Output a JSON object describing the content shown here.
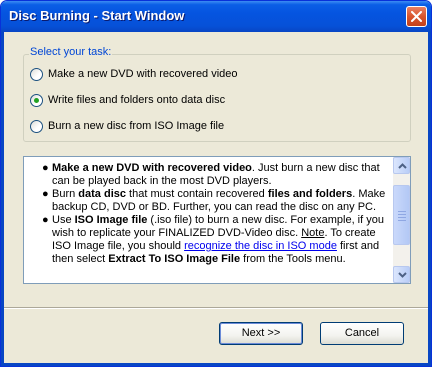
{
  "window": {
    "title": "Disc Burning - Start Window"
  },
  "task_group": {
    "label": "Select your task:",
    "options": [
      {
        "label": "Make a new DVD with recovered video",
        "selected": false
      },
      {
        "label": "Write files and folders onto data disc",
        "selected": true
      },
      {
        "label": "Burn a new disc from ISO Image file",
        "selected": false
      }
    ]
  },
  "description": {
    "b1": {
      "strong": "Make a new DVD with recovered video",
      "text": ". Just burn a new disc that can be played back in the most DVD players."
    },
    "b2": {
      "t1": "Burn ",
      "strong1": "data disc",
      "t2": " that must contain recovered ",
      "strong2": "files and folders",
      "t3": ". Make backup CD, DVD or BD. Further, you can read the disc on any PC."
    },
    "b3": {
      "t1": "Use ",
      "strong1": "ISO Image file",
      "t2": " (.iso file) to burn a new disc. For example, if you wish to replicate your FINALIZED DVD-Video disc. ",
      "note": "Note",
      "t3": ". To create ISO Image file, you should ",
      "link": "recognize the disc in ISO mode",
      "t4": " first and then select ",
      "strong2": "Extract To ISO Image File",
      "t5": " from the Tools menu."
    }
  },
  "buttons": {
    "next": "Next >>",
    "cancel": "Cancel"
  },
  "icons": {
    "close": "close-x-icon",
    "scroll_up": "arrow-up-icon",
    "scroll_down": "arrow-down-icon"
  },
  "colors": {
    "title_bar": "#0554e0",
    "dialog_bg": "#ece9d8",
    "group_label": "#0046d5",
    "radio_dot": "#21a121",
    "link": "#0000ee"
  }
}
